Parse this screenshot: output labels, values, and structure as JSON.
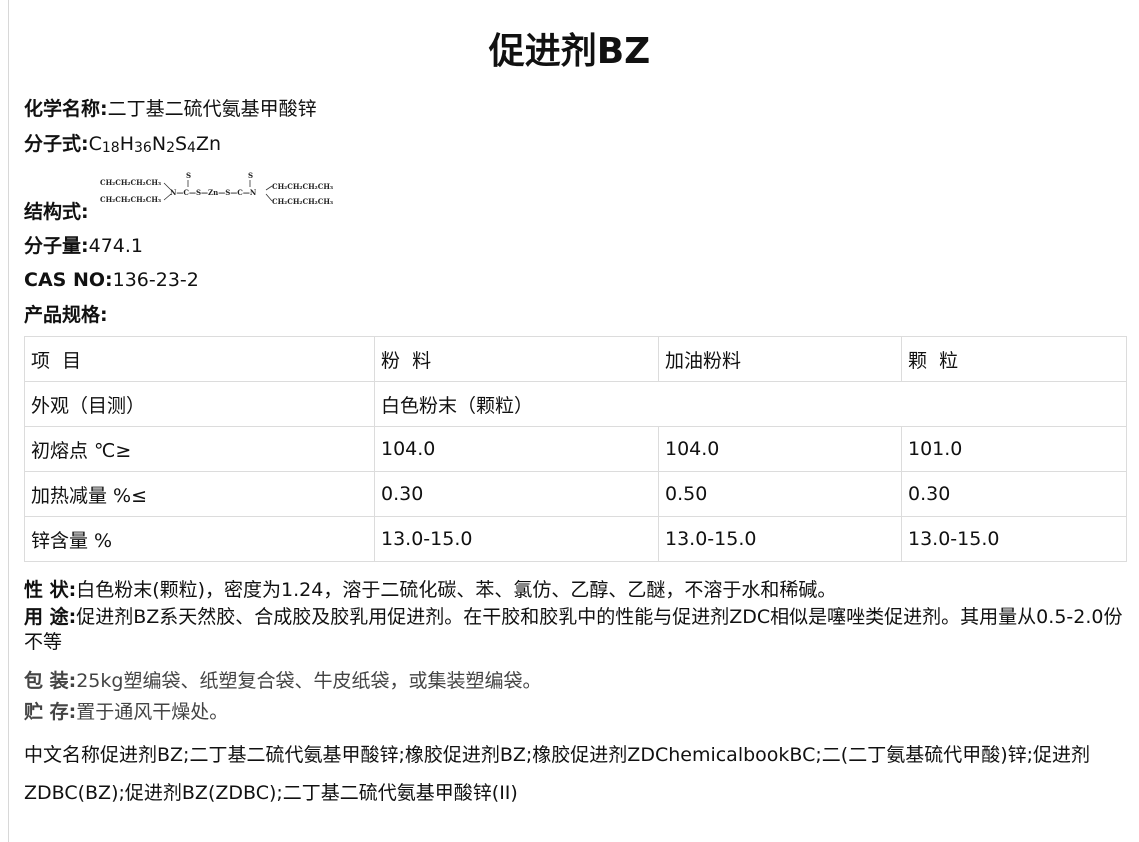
{
  "title": "促进剂BZ",
  "chemical_name": {
    "label": "化学名称:",
    "value": "二丁基二硫代氨基甲酸锌"
  },
  "formula": {
    "label": "分子式:",
    "parts": [
      "C",
      "18",
      "H",
      "36",
      "N",
      "2",
      "S",
      "4",
      "Zn"
    ]
  },
  "structure": {
    "label": "结构式:",
    "left_top": "CH₂CH₂CH₂CH₃",
    "left_bottom": "CH₂CH₂CH₂CH₃",
    "chain": "N—C—S—Zn—S—C—N",
    "s_upper": "S",
    "right_top": "CH₂CH₂CH₂CH₃",
    "right_bottom": "CH₂CH₂CH₂CH₃"
  },
  "weight": {
    "label": "分子量:",
    "value": "474.1"
  },
  "cas": {
    "label": "CAS NO:",
    "value": "136-23-2"
  },
  "spec_label": "产品规格:",
  "table": {
    "header": [
      "项  目",
      "粉  料",
      "加油粉料",
      "颗  粒"
    ],
    "appearance": {
      "item": "外观（目测）",
      "value": "白色粉末（颗粒）"
    },
    "rows": [
      {
        "item": "初熔点 ℃≥",
        "values": [
          "104.0",
          "104.0",
          "101.0"
        ]
      },
      {
        "item": "加热减量 %≤",
        "values": [
          "0.30",
          "0.50",
          "0.30"
        ]
      },
      {
        "item": "锌含量 %",
        "values": [
          "13.0-15.0",
          "13.0-15.0",
          "13.0-15.0"
        ]
      }
    ]
  },
  "properties": {
    "label": "性 状:",
    "text": "白色粉末(颗粒)，密度为1.24，溶于二硫化碳、苯、氯仿、乙醇、乙醚，不溶于水和稀碱。"
  },
  "usage": {
    "label": "用 途:",
    "text": "促进剂BZ系天然胶、合成胶及胶乳用促进剂。在干胶和胶乳中的性能与促进剂ZDC相似是噻唑类促进剂。其用量从0.5-2.0份不等"
  },
  "packaging": {
    "label": "包 装:",
    "text": "25kg塑编袋、纸塑复合袋、牛皮纸袋，或集装塑编袋。"
  },
  "storage": {
    "label": "贮 存:",
    "text": "置于通风干燥处。"
  },
  "synonyms": "中文名称促进剂BZ;二丁基二硫代氨基甲酸锌;橡胶促进剂BZ;橡胶促进剂ZDChemicalbookBC;二(二丁氨基硫代甲酸)锌;促进剂ZDBC(BZ);促进剂BZ(ZDBC);二丁基二硫代氨基甲酸锌(II)"
}
